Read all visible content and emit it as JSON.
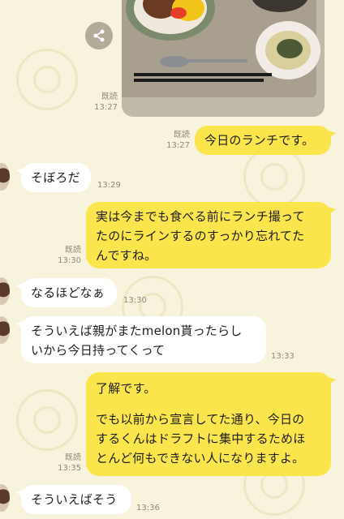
{
  "photo": {
    "icon": "share-icon"
  },
  "messages": [
    {
      "id": "m1",
      "side": "mine",
      "text": "今日のランチです。",
      "read": "既読",
      "time": "13:27"
    },
    {
      "id": "m2",
      "side": "theirs",
      "text": "そぼろだ",
      "time": "13:29"
    },
    {
      "id": "m3",
      "side": "mine",
      "lines": [
        "実は今までも食べる前にランチ撮って",
        "たのにラインするのすっかり忘れてた",
        "んですね。"
      ],
      "read": "既読",
      "time": "13:30"
    },
    {
      "id": "m4",
      "side": "theirs",
      "text": "なるほどなぁ",
      "time": "13:30"
    },
    {
      "id": "m5",
      "side": "theirs",
      "lines": [
        "そういえば親がまたmelon貰ったらし",
        "いから今日持ってくって"
      ],
      "time": "13:33"
    },
    {
      "id": "m6",
      "side": "mine",
      "lines": [
        "了解です。",
        "",
        "でも以前から宣言してた通り、今日の",
        "するくんはドラフトに集中するためほ",
        "とんど何もできない人になりますよ。"
      ],
      "read": "既読",
      "time": "13:35"
    },
    {
      "id": "m7",
      "side": "theirs",
      "text": "そういえばそう",
      "time": "13:36"
    }
  ],
  "photo_meta": {
    "read": "既読",
    "time": "13:27"
  }
}
